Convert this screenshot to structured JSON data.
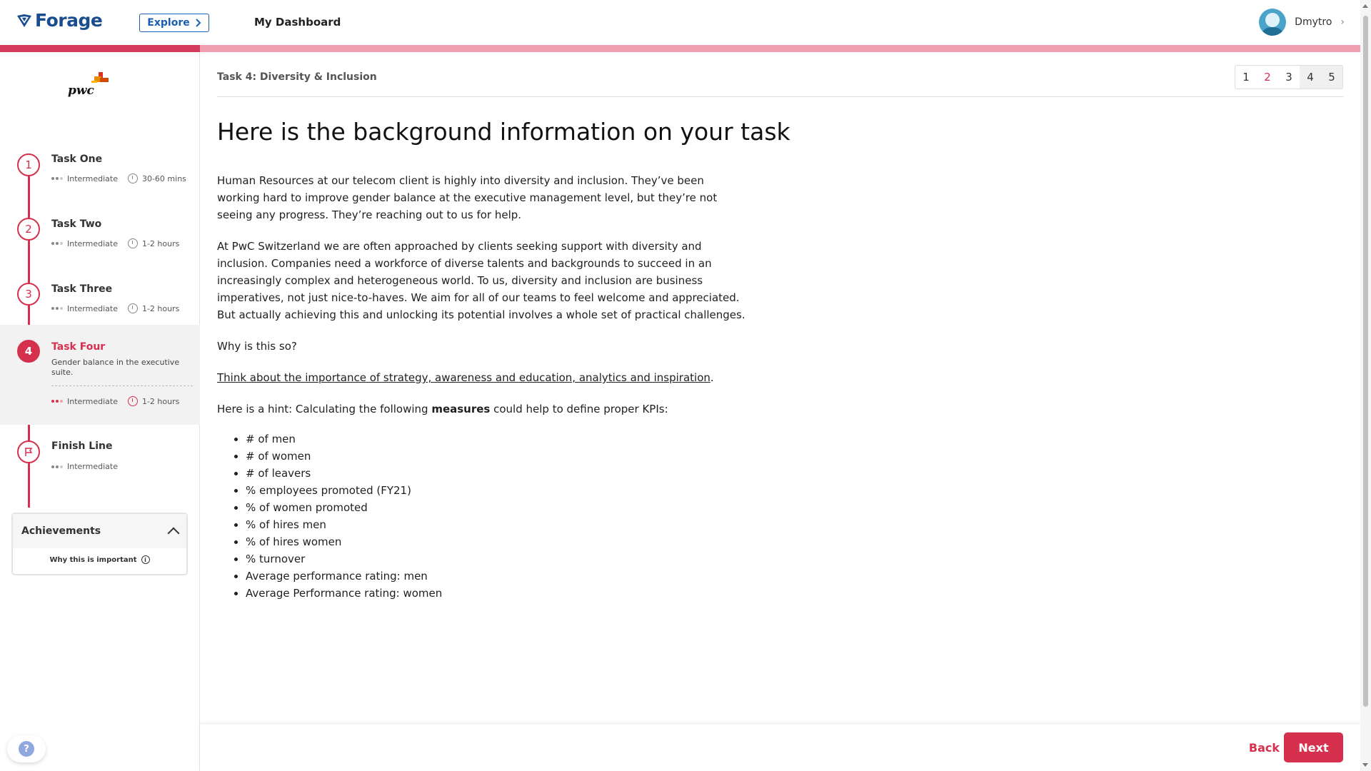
{
  "header": {
    "logo_text": "Forage",
    "explore_label": "Explore",
    "dashboard_label": "My Dashboard",
    "user_name": "Dmytro"
  },
  "sidebar": {
    "company_logo": "pwc",
    "tasks": [
      {
        "number": "1",
        "title": "Task One",
        "level": "Intermediate",
        "duration": "30-60 mins"
      },
      {
        "number": "2",
        "title": "Task Two",
        "level": "Intermediate",
        "duration": "1-2 hours"
      },
      {
        "number": "3",
        "title": "Task Three",
        "level": "Intermediate",
        "duration": "1-2 hours"
      },
      {
        "number": "4",
        "title": "Task Four",
        "description": "Gender balance in the executive suite.",
        "level": "Intermediate",
        "duration": "1-2 hours"
      },
      {
        "title": "Finish Line",
        "level": "Intermediate"
      }
    ],
    "achievements": {
      "title": "Achievements",
      "why_label": "Why this is important"
    }
  },
  "main": {
    "breadcrumb": "Task 4: Diversity & Inclusion",
    "pager": [
      "1",
      "2",
      "3",
      "4",
      "5"
    ],
    "heading": "Here is the background information on your task",
    "p1": "Human Resources at our telecom client is highly into diversity and inclusion. They’ve been working hard to improve gender balance at the executive management level, but they’re not seeing any progress. They’re reaching out to us for help.",
    "p2": "At PwC Switzerland we are often approached by clients seeking support with diversity and inclusion. Companies need a workforce of diverse talents and backgrounds to succeed in an increasingly complex and heterogeneous world. To us, diversity and inclusion are business imperatives, not just nice-to-haves. We aim for all of our teams to feel welcome and appreciated. But actually achieving this and unlocking its potential involves a whole set of practical challenges.",
    "p3": "Why is this so?",
    "link_text": "Think about the importance of strategy, awareness and education, analytics and inspiration",
    "link_suffix": ".",
    "hint_before": "Here is a hint: Calculating the following ",
    "hint_bold": "measures",
    "hint_after": " could help to define proper KPIs:",
    "measures": [
      "# of men",
      "# of women",
      "# of leavers",
      "% employees promoted (FY21)",
      "% of women promoted",
      "% of hires men",
      "% of hires women",
      "% turnover",
      "Average performance rating: men",
      "Average Performance rating: women"
    ]
  },
  "footer": {
    "back_label": "Back",
    "next_label": "Next"
  },
  "colors": {
    "accent": "#d6304f",
    "accent_light": "#ef9fb0",
    "brand_blue": "#1a5fb4"
  },
  "icons": [
    "forage-logo-icon",
    "chevron-right-icon",
    "avatar-icon",
    "clock-icon",
    "flag-icon",
    "chevron-up-icon",
    "info-icon",
    "help-icon"
  ]
}
